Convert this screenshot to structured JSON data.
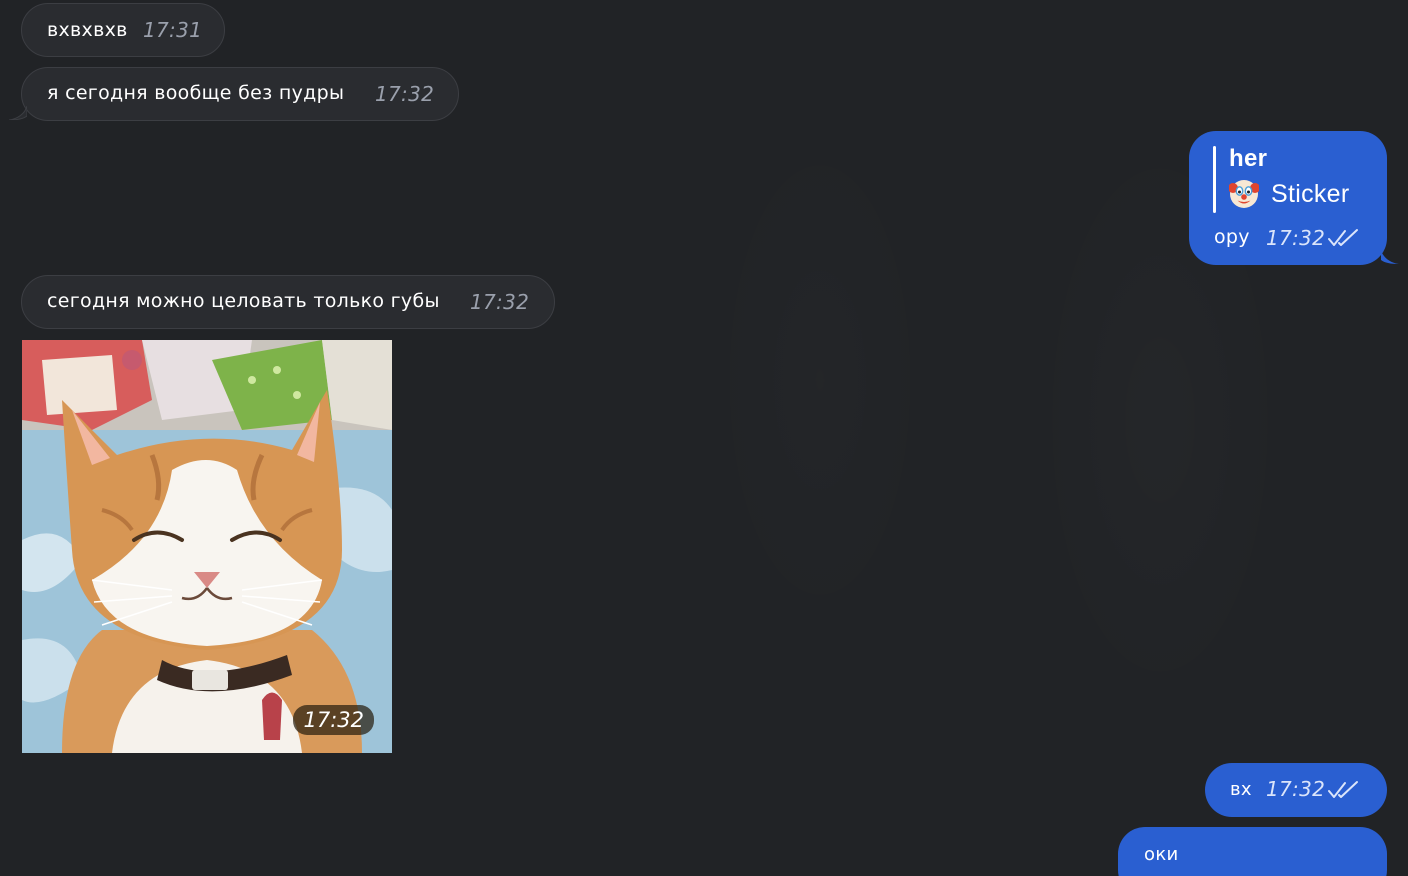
{
  "messages": [
    {
      "id": "m1",
      "direction": "incoming",
      "text": "вхвхвхв",
      "time": "17:31"
    },
    {
      "id": "m2",
      "direction": "incoming",
      "text": "я сегодня вообще без пудры",
      "time": "17:32"
    },
    {
      "id": "m3",
      "direction": "outgoing",
      "reply": {
        "author": "her",
        "preview": "Sticker",
        "preview_icon": "clown-emoji-icon"
      },
      "text": "ору",
      "time": "17:32",
      "status": "read"
    },
    {
      "id": "m4",
      "direction": "incoming",
      "text": "сегодня можно целовать только губы",
      "time": "17:32"
    },
    {
      "id": "m5",
      "direction": "incoming",
      "type": "gif",
      "media_subject": "smiling-cat",
      "time": "17:32"
    },
    {
      "id": "m6",
      "direction": "outgoing",
      "text": "вх",
      "time": "17:32",
      "status": "read"
    },
    {
      "id": "m7",
      "direction": "outgoing",
      "text": "оки"
    }
  ],
  "colors": {
    "background": "#212326",
    "incoming_bubble": "#2a2c30",
    "incoming_border": "#3c3e43",
    "outgoing_bubble": "#2a5fd1",
    "time_incoming": "#9aa0ac",
    "time_outgoing": "#dbe5fb"
  }
}
